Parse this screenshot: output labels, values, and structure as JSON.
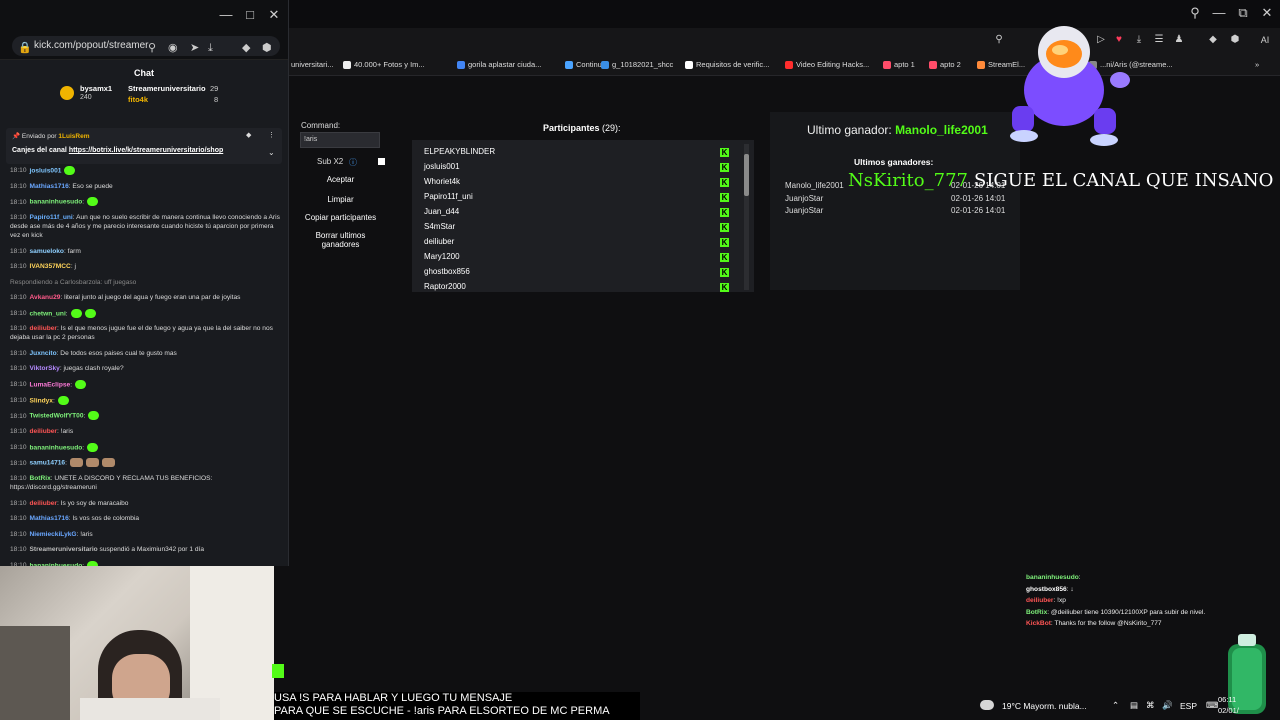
{
  "chat_window": {
    "url": "kick.com/popout/streamer",
    "header": "Chat",
    "leaderboard": [
      {
        "name": "bysamx1",
        "count": "240"
      },
      {
        "name": "Streameruniversitario",
        "count": "29"
      },
      {
        "name": "fito4k",
        "count": "8"
      }
    ],
    "pinned": {
      "sent_by_label": "Enviado por",
      "sent_by_user": "1LuisRem",
      "prefix": "Canjes del canal",
      "link": "https://botrix.live/k/streameruniversitario/shop"
    },
    "messages": [
      {
        "ts": "18:10",
        "user": "josluis001",
        "color": "#7fc6ff",
        "text": "",
        "emotes": 1
      },
      {
        "ts": "18:10",
        "user": "Mathias1716",
        "color": "#6aa7ff",
        "text": ": Eso se puede",
        "emotes": 0
      },
      {
        "ts": "18:10",
        "user": "bananinhuesudo",
        "color": "#7ef07a",
        "text": ":",
        "emotes": 1
      },
      {
        "ts": "18:10",
        "user": "Papiro11f_uni",
        "color": "#6ab0ff",
        "text": ": Aun que no suelo escribir de manera continua llevo conociendo a Aris desde ase más de 4 años y me parecio interesante cuando hiciste tú aparcion por primera vez en kick",
        "emotes": 0
      },
      {
        "ts": "18:10",
        "user": "samueloko",
        "color": "#8fd0ff",
        "text": ": farm",
        "emotes": 0
      },
      {
        "ts": "18:10",
        "user": "IVAN357MCC",
        "color": "#ffd45a",
        "text": ": j",
        "emotes": 0
      },
      {
        "ts": "",
        "user": "",
        "color": "#888",
        "text": "Respondiendo a Carlosbarzola: uff juegaso",
        "emotes": 0
      },
      {
        "ts": "18:10",
        "user": "Avkanu29",
        "color": "#ff5a8a",
        "text": ": literal junto al juego del agua y fuego eran una par de joyitas",
        "emotes": 0
      },
      {
        "ts": "18:10",
        "user": "chetwn_uni",
        "color": "#7ef07a",
        "text": ":",
        "emotes": 2
      },
      {
        "ts": "18:10",
        "user": "deiliuber",
        "color": "#ff5555",
        "text": ": Is el que menos jugue fue el de fuego y agua ya que la del saiber no nos dejaba usar la pc 2 personas",
        "emotes": 0
      },
      {
        "ts": "18:10",
        "user": "Juxncito",
        "color": "#7fc6ff",
        "text": ": De todos esos paises cual te gusto mas",
        "emotes": 0
      },
      {
        "ts": "18:10",
        "user": "ViktorSky",
        "color": "#b58aff",
        "text": ": juegas clash royale?",
        "emotes": 0
      },
      {
        "ts": "18:10",
        "user": "LumaEclipse",
        "color": "#ff7ad9",
        "text": ":",
        "emotes": 1
      },
      {
        "ts": "18:10",
        "user": "Slindyx",
        "color": "#ffd45a",
        "text": ":",
        "emotes": 1
      },
      {
        "ts": "18:10",
        "user": "TwistedWolfYT00",
        "color": "#7ef07a",
        "text": ":",
        "emotes": 1
      },
      {
        "ts": "18:10",
        "user": "deiliuber",
        "color": "#ff5555",
        "text": ": !aris",
        "emotes": 0
      },
      {
        "ts": "18:10",
        "user": "bananinhuesudo",
        "color": "#7ef07a",
        "text": ":",
        "emotes": 1
      },
      {
        "ts": "18:10",
        "user": "samu14716",
        "color": "#8fd0ff",
        "text": ":",
        "emotes": 3
      },
      {
        "ts": "18:10",
        "user": "BotRix",
        "color": "#7ef07a",
        "text": ": UNETE A DISCORD Y RECLAMA TUS BENEFICIOS: https://discord.gg/streameruni",
        "emotes": 0
      },
      {
        "ts": "18:10",
        "user": "deiliuber",
        "color": "#ff5555",
        "text": ": Is yo soy de maracaibo",
        "emotes": 0
      },
      {
        "ts": "18:10",
        "user": "Mathias1716",
        "color": "#6aa7ff",
        "text": ": Is vos sos de colombia",
        "emotes": 0
      },
      {
        "ts": "18:10",
        "user": "NiemieckiLykG",
        "color": "#6aa7ff",
        "text": ": !aris",
        "emotes": 0
      },
      {
        "ts": "18:10",
        "user": "Streameruniversitario",
        "color": "#bbbbbb",
        "text": " suspendió a Maximiun342 por 1 día",
        "emotes": 0
      },
      {
        "ts": "18:10",
        "user": "bananinhuesudo",
        "color": "#7ef07a",
        "text": ":",
        "emotes": 1
      }
    ]
  },
  "bookmarks": [
    "universitari...",
    "40.000+ Fotos y Im...",
    "gorila aplastar ciuda...",
    "Continue",
    "g_10182021_shcc",
    "Requisitos de verific...",
    "Video Editing Hacks...",
    "apto 1",
    "apto 2",
    "StreamEl...",
    "...ni/Aris (@streame..."
  ],
  "controls": {
    "command_label": "Command:",
    "command_value": "!aris",
    "sub_label": "Sub X2",
    "accept": "Aceptar",
    "clear": "Limpiar",
    "copy": "Copiar participantes",
    "delete_winners": "Borrar ultimos ganadores"
  },
  "participants": {
    "title": "Participantes",
    "count": "(29):",
    "names": [
      "ELPEAKYBLINDER",
      "josluis001",
      "Whoriet4k",
      "Papiro11f_uni",
      "Juan_d44",
      "S4mStar",
      "deiliuber",
      "Mary1200",
      "ghostbox856",
      "Raptor2000"
    ]
  },
  "winners": {
    "last_winner_label": "Ultimo ganador:",
    "last_winner": "Manolo_life2001",
    "recent_label": "Ultimos ganadores:",
    "recent": [
      {
        "name": "Manolo_life2001",
        "date": "02-01-26 14:01"
      },
      {
        "name": "JuanjoStar",
        "date": "02-01-26 14:01"
      },
      {
        "name": "JuanjoStar",
        "date": "02-01-26 14:01"
      }
    ]
  },
  "overlay": {
    "follower": "NsKirito_777",
    "message": "SIGUE EL CANAL QUE INSANO"
  },
  "stream_chat": [
    {
      "user": "bananinhuesudo",
      "color": "#7ef07a",
      "text": ":"
    },
    {
      "user": "ghostbox856",
      "color": "#ffffff",
      "text": ": ↓"
    },
    {
      "user": "deiliuber",
      "color": "#ff5555",
      "text": ": !xp"
    },
    {
      "user": "BotRix",
      "color": "#7ef07a",
      "text": ": @deiliuber tiene 10390/12100XP para subir de nivel."
    },
    {
      "user": "KickBot",
      "color": "#ff5555",
      "text": ": Thanks for the follow @NsKirito_777"
    }
  ],
  "caption": {
    "line1": "USA !S PARA HABLAR Y LUEGO TU MENSAJE",
    "line2": "PARA QUE SE ESCUCHE - !aris PARA ELSORTEO DE MC PERMA"
  },
  "taskbar": {
    "weather": "19°C  Mayorm. nubla...",
    "lang": "ESP",
    "time": "06:11",
    "date": "02/01/"
  }
}
